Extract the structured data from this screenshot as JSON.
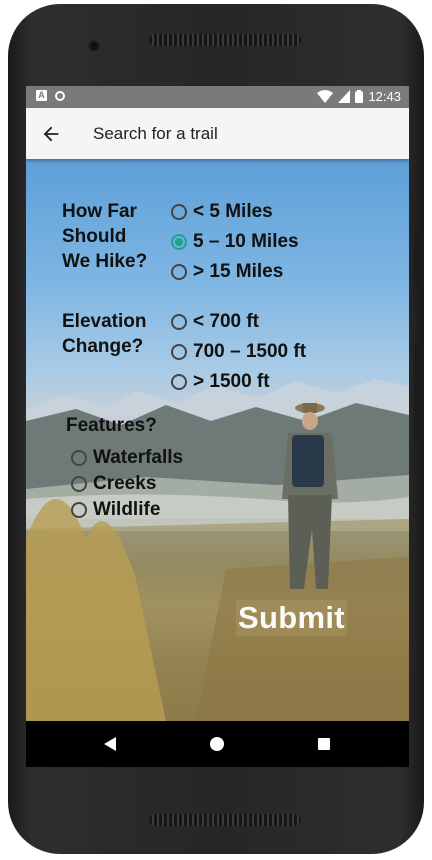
{
  "status_bar": {
    "time": "12:43",
    "left_icons": [
      "a-notification-icon",
      "circle-notification-icon"
    ],
    "right_icons": [
      "wifi-icon",
      "signal-icon",
      "battery-icon"
    ]
  },
  "app_bar": {
    "title": "Search for a trail",
    "back_icon": "arrow-back-icon"
  },
  "form": {
    "distance": {
      "question": [
        "How Far",
        "Should",
        "We Hike?"
      ],
      "options": [
        {
          "label": "< 5 Miles",
          "checked": false
        },
        {
          "label": "5 – 10 Miles",
          "checked": true
        },
        {
          "label": "> 15 Miles",
          "checked": false
        }
      ]
    },
    "elevation": {
      "question": [
        "Elevation",
        "Change?"
      ],
      "options": [
        {
          "label": "< 700 ft",
          "checked": false
        },
        {
          "label": "700 – 1500 ft",
          "checked": false
        },
        {
          "label": "> 1500 ft",
          "checked": false
        }
      ]
    },
    "features": {
      "question": "Features?",
      "options": [
        {
          "label": "Waterfalls",
          "checked": false
        },
        {
          "label": "Creeks",
          "checked": false
        },
        {
          "label": "Wildlife",
          "checked": false
        }
      ]
    },
    "submit_label": "Submit"
  },
  "accent_color": "#1aa58a",
  "nav_bar": {
    "icons": [
      "back-triangle-icon",
      "home-circle-icon",
      "recents-square-icon"
    ]
  }
}
